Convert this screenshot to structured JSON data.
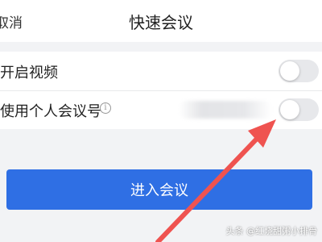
{
  "header": {
    "cancel_label": "取消",
    "title": "快速会议"
  },
  "settings": {
    "enable_video": {
      "label": "开启视频",
      "enabled": false
    },
    "personal_meeting_id": {
      "label": "使用个人会议号",
      "info_icon": "info-icon",
      "enabled": false
    }
  },
  "actions": {
    "enter_label": "进入会议"
  },
  "colors": {
    "primary": "#2f6fe4",
    "arrow": "#ef5350",
    "toggle_off": "#e7e8eb"
  },
  "watermark": "头条 @红烧甜粥小排骨"
}
